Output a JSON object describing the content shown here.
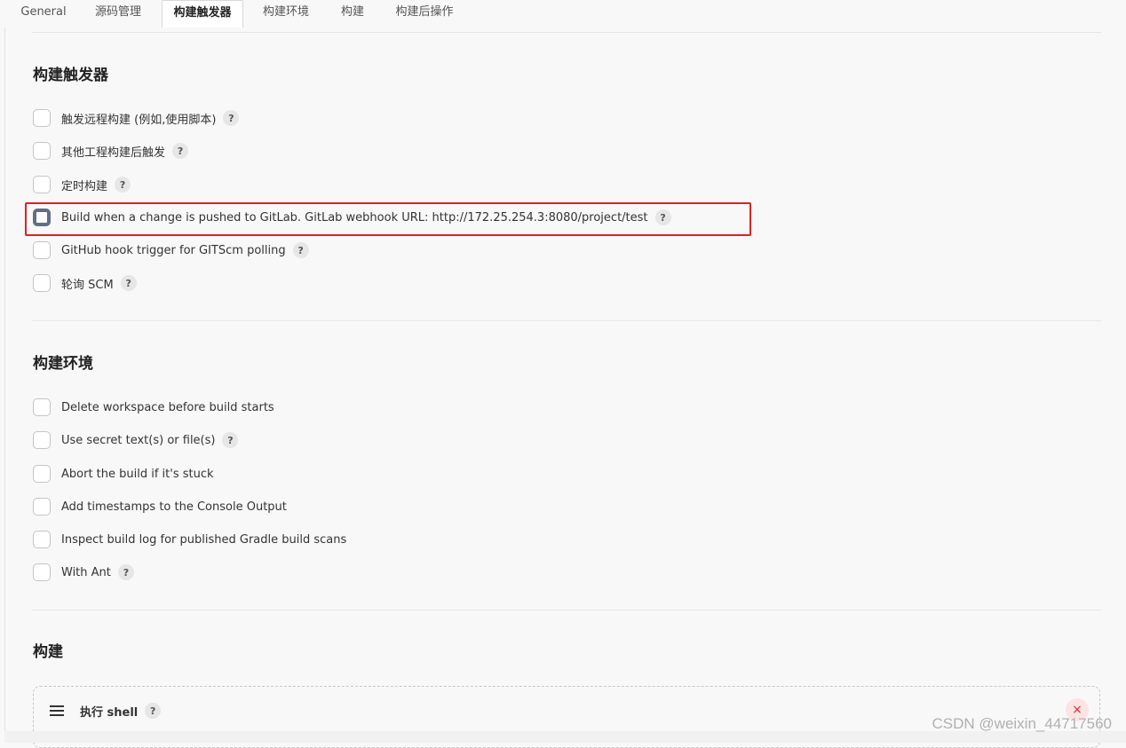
{
  "tabs": [
    {
      "label": "General"
    },
    {
      "label": "源码管理"
    },
    {
      "label": "构建触发器"
    },
    {
      "label": "构建环境"
    },
    {
      "label": "构建"
    },
    {
      "label": "构建后操作"
    }
  ],
  "triggers": {
    "title": "构建触发器",
    "options": [
      {
        "label": "触发远程构建 (例如,使用脚本)",
        "help": "?"
      },
      {
        "label": "其他工程构建后触发",
        "help": "?"
      },
      {
        "label": "定时构建",
        "help": "?"
      },
      {
        "label": "Build when a change is pushed to GitLab. GitLab webhook URL: http://172.25.254.3:8080/project/test",
        "help": "?"
      },
      {
        "label": "GitHub hook trigger for GITScm polling",
        "help": "?"
      },
      {
        "label": "轮询 SCM",
        "help": "?"
      }
    ]
  },
  "environment": {
    "title": "构建环境",
    "options": [
      {
        "label": "Delete workspace before build starts"
      },
      {
        "label": "Use secret text(s) or file(s)",
        "help": "?"
      },
      {
        "label": "Abort the build if it's stuck"
      },
      {
        "label": "Add timestamps to the Console Output"
      },
      {
        "label": "Inspect build log for published Gradle build scans"
      },
      {
        "label": "With Ant",
        "help": "?"
      }
    ]
  },
  "build": {
    "title": "构建",
    "step": {
      "label": "执行 shell",
      "help": "?",
      "close": "×"
    }
  },
  "watermark": "CSDN @weixin_44717560",
  "colors": {
    "highlight": "#e02020",
    "focused_checkbox": "#5f7086"
  }
}
